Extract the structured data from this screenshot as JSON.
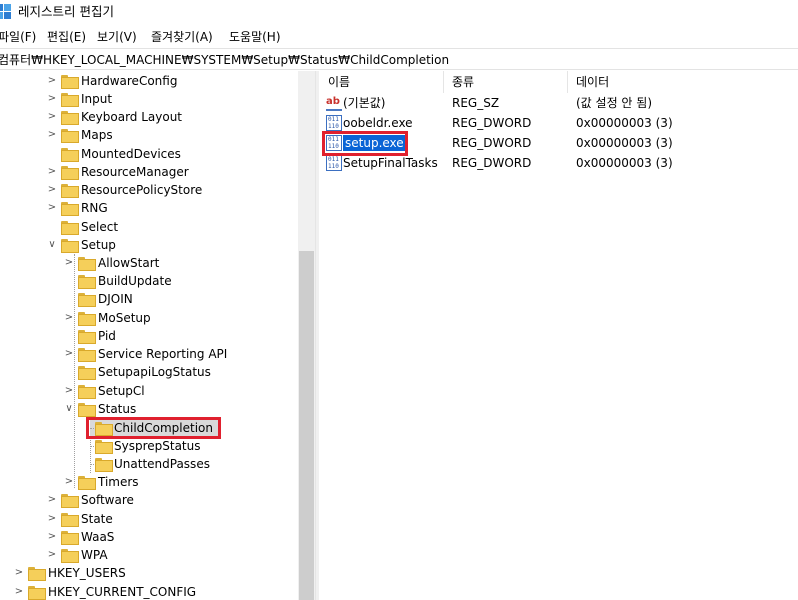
{
  "window": {
    "title": "레지스트리 편집기"
  },
  "menu": [
    {
      "label": "파일(F)"
    },
    {
      "label": "편집(E)"
    },
    {
      "label": "보기(V)"
    },
    {
      "label": "즐겨찾기(A)"
    },
    {
      "label": "도움말(H)"
    }
  ],
  "address": {
    "path": "컴퓨터₩HKEY_LOCAL_MACHINE₩SYSTEM₩Setup₩Status₩ChildCompletion"
  },
  "tree": {
    "items": [
      {
        "label": "HardwareConfig"
      },
      {
        "label": "Input"
      },
      {
        "label": "Keyboard Layout"
      },
      {
        "label": "Maps"
      },
      {
        "label": "MountedDevices"
      },
      {
        "label": "ResourceManager"
      },
      {
        "label": "ResourcePolicyStore"
      },
      {
        "label": "RNG"
      },
      {
        "label": "Select"
      },
      {
        "label": "Setup"
      },
      {
        "label": "AllowStart"
      },
      {
        "label": "BuildUpdate"
      },
      {
        "label": "DJOIN"
      },
      {
        "label": "MoSetup"
      },
      {
        "label": "Pid"
      },
      {
        "label": "Service Reporting API"
      },
      {
        "label": "SetupapiLogStatus"
      },
      {
        "label": "SetupCl"
      },
      {
        "label": "Status"
      },
      {
        "label": "ChildCompletion"
      },
      {
        "label": "SysprepStatus"
      },
      {
        "label": "UnattendPasses"
      },
      {
        "label": "Timers"
      },
      {
        "label": "Software"
      },
      {
        "label": "State"
      },
      {
        "label": "WaaS"
      },
      {
        "label": "WPA"
      },
      {
        "label": "HKEY_USERS"
      },
      {
        "label": "HKEY_CURRENT_CONFIG"
      }
    ]
  },
  "list": {
    "columns": [
      {
        "label": "이름"
      },
      {
        "label": "종류"
      },
      {
        "label": "데이터"
      }
    ],
    "rows": [
      {
        "name": "(기본값)",
        "type": "REG_SZ",
        "data": "(값 설정 안 됨)",
        "icon": "string-value-icon"
      },
      {
        "name": "oobeldr.exe",
        "type": "REG_DWORD",
        "data": "0x00000003 (3)",
        "icon": "binary-value-icon"
      },
      {
        "name": "setup.exe",
        "type": "REG_DWORD",
        "data": "0x00000003 (3)",
        "icon": "binary-value-icon"
      },
      {
        "name": "SetupFinalTasks",
        "type": "REG_DWORD",
        "data": "0x00000003 (3)",
        "icon": "binary-value-icon"
      }
    ]
  },
  "icons": {
    "ab_glyph": "ab"
  },
  "colors": {
    "highlight": "#e0202e",
    "selection": "#0a64d6",
    "folder": "#f5cf5a"
  }
}
